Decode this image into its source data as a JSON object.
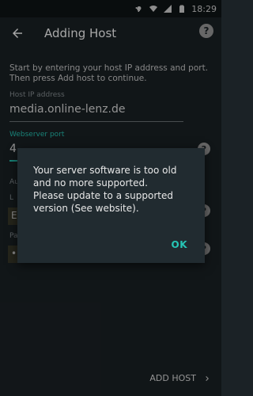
{
  "status_bar": {
    "time": "18:29",
    "icons": [
      "key-icon",
      "wifi-icon",
      "signal-icon",
      "battery-icon"
    ]
  },
  "toolbar": {
    "title": "Adding Host",
    "help_label": "?"
  },
  "form": {
    "intro": "Start by entering your host IP address and port. Then press Add host to continue.",
    "host_label": "Host IP address",
    "host_value": "media.online-lenz.de",
    "port_label": "Webserver port",
    "port_value": "4",
    "port_value_tail": "",
    "partial_label_1": "Au",
    "partial_label_2": "L",
    "partial_input_1": "E",
    "partial_label_3": "Pa",
    "partial_input_2": "•",
    "help_label": "?"
  },
  "dialog": {
    "message_line1": "Your server software is too old and no more supported.",
    "message_line2": "Please update to a supported version (See website).",
    "ok_label": "OK"
  },
  "bottom": {
    "add_host_label": "ADD HOST"
  },
  "colors": {
    "background": "#1b2226",
    "accent": "#26c6b6",
    "dialog": "#212b30"
  }
}
